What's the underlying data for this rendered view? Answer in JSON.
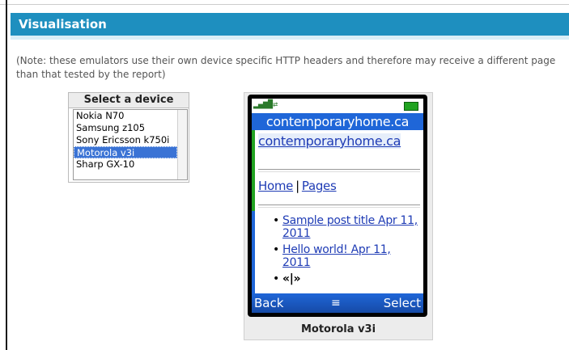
{
  "section": {
    "title": "Visualisation"
  },
  "note": "(Note: these emulators use their own device specific HTTP headers and therefore may receive a different page than that tested by the report)",
  "device_selector": {
    "title": "Select a device",
    "options": [
      "Nokia N70",
      "Samsung z105",
      "Sony Ericsson k750i",
      "Motorola v3i",
      "Sharp GX-10"
    ],
    "selected": "Motorola v3i"
  },
  "emulator": {
    "site_bar": "contemporaryhome.ca",
    "site_link": "contemporaryhome.ca",
    "nav": {
      "home": "Home",
      "separator": "|",
      "pages": "Pages"
    },
    "posts": [
      "Sample post title Apr 11, 2011",
      "Hello world! Apr 11, 2011"
    ],
    "pager": "«|»",
    "softkeys": {
      "left": "Back",
      "center": "≡",
      "right": "Select"
    },
    "device_label": "Motorola v3i"
  },
  "colors": {
    "header_bg": "#1e8fbf",
    "selection": "#3a73d5",
    "phone_blue": "#1f66d8",
    "battery_green": "#21a321"
  }
}
